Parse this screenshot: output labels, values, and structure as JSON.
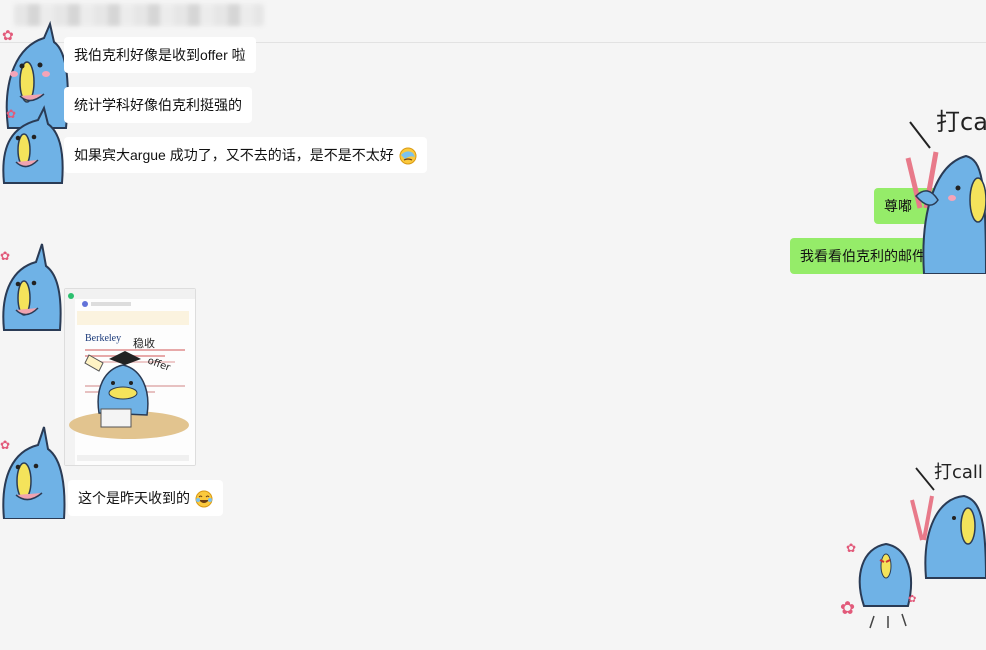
{
  "header": {
    "contact_name_redacted": true
  },
  "messages": {
    "m1": "我伯克利好像是收到offer 啦",
    "m2": "统计学科好像伯克利挺强的",
    "m3": "如果宾大argue 成功了，又不去的话，是不是不太好",
    "m4": "尊嘟",
    "m5": "我看看伯克利的邮件",
    "m6": "这个是昨天收到的"
  },
  "image_message": {
    "brand": "Berkeley",
    "sticker_caption": "稳收",
    "sticker_caption2": "offer"
  },
  "stickers": {
    "dacall_text": "打call"
  },
  "colors": {
    "background": "#f5f5f5",
    "incoming_bubble": "#ffffff",
    "outgoing_bubble": "#95ec69",
    "mascot_blue": "#6fb2e6",
    "mascot_yellow": "#f4e35b"
  }
}
